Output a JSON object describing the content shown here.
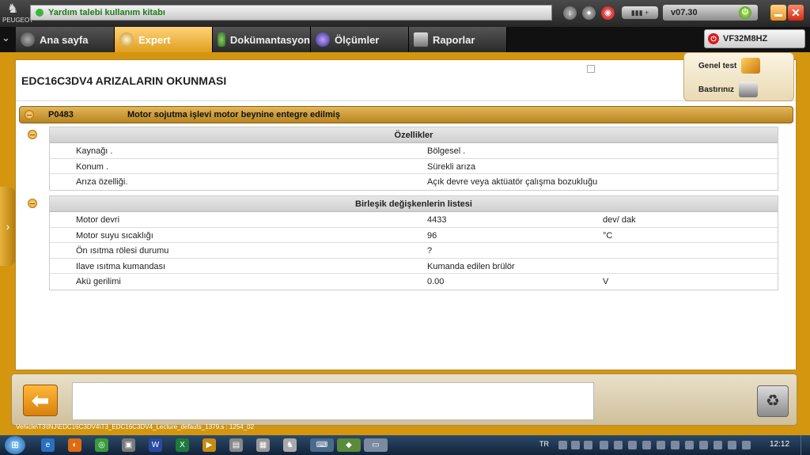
{
  "header": {
    "brand": "PEUGEOT",
    "help_text": "Yardım talebi kullanım kitabı",
    "version": "v07.30",
    "vin": "VF32M8HZ"
  },
  "tabs": [
    {
      "label": "Ana sayfa",
      "active": false
    },
    {
      "label": "Expert",
      "active": true
    },
    {
      "label": "Dokümantasyon",
      "active": false
    },
    {
      "label": "Ölçümler",
      "active": false
    },
    {
      "label": "Raporlar",
      "active": false
    }
  ],
  "page": {
    "title": "EDC16C3DV4  ARIZALARIN OKUNMASI"
  },
  "side_panel": {
    "general_test": "Genel test",
    "print": "Bastırınız"
  },
  "fault": {
    "code": "P0483",
    "description": "Motor sojutma işlevi motor beynine entegre edilmiş"
  },
  "properties": {
    "title": "Özellikler",
    "rows": [
      {
        "label": "Kaynağı .",
        "value": "Bölgesel ."
      },
      {
        "label": "Konum .",
        "value": "Sürekli arıza"
      },
      {
        "label": "Arıza özelliği.",
        "value": "Açık devre veya aktüatör çalışma bozukluğu"
      }
    ]
  },
  "variables": {
    "title": "Birleşik değişkenlerin listesi",
    "rows": [
      {
        "label": "Motor devri",
        "value": "4433",
        "unit": "dev/ dak"
      },
      {
        "label": "Motor suyu sıcaklığı",
        "value": "96",
        "unit": "°C"
      },
      {
        "label": "Ön ısıtma rölesi durumu",
        "value": "?",
        "unit": ""
      },
      {
        "label": "Ilave ısıtma kumandası",
        "value": "Kumanda edilen brülör",
        "unit": ""
      },
      {
        "label": "Akü gerilimi",
        "value": "0.00",
        "unit": "V"
      }
    ]
  },
  "footer": {
    "path": "Vehicle\\T3\\INJ\\EDC16C3DV4\\T3_EDC16C3DV4_Lecture_defauts_1379.s : 1254_02"
  },
  "taskbar": {
    "language": "TR",
    "clock": "12:12"
  },
  "colors": {
    "accent": "#d4960f",
    "fault_bar": "#c99a36",
    "active_tab": "#e8a82a"
  }
}
